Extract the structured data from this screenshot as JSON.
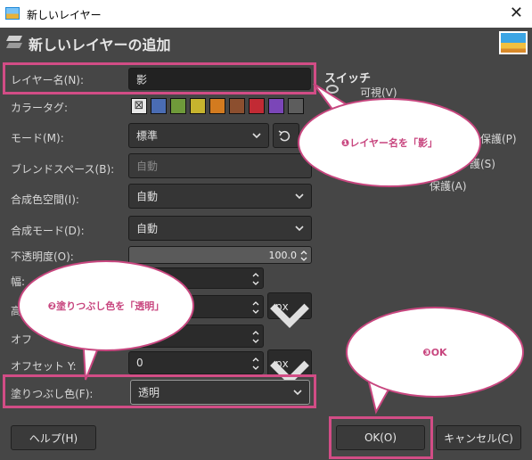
{
  "window": {
    "title": "新しいレイヤー",
    "close": "✕"
  },
  "dialog": {
    "heading": "新しいレイヤーの追加"
  },
  "form": {
    "layer_name_label": "レイヤー名(N):",
    "layer_name_value": "影",
    "color_tag_label": "カラータグ:",
    "mode_label": "モード(M):",
    "mode_value": "標準",
    "blend_space_label": "ブレンドスペース(B):",
    "blend_space_value": "自動",
    "composite_space_label": "合成色空間(I):",
    "composite_space_value": "自動",
    "composite_mode_label": "合成モード(D):",
    "composite_mode_value": "自動",
    "opacity_label": "不透明度(O):",
    "opacity_value": "100.0",
    "width_label": "幅:",
    "height_label_partial": "高",
    "offset_x_label_partial": "オフ",
    "offset_y_label": "オフセット Y:",
    "offset_y_value": "0",
    "unit_top": "px",
    "unit_bottom": "px",
    "fill_label": "塗りつぶし色(F):",
    "fill_value": "透明"
  },
  "color_tags": [
    "#777777",
    "#4a6cb3",
    "#6f9a3a",
    "#c7b42e",
    "#d37b1f",
    "#8c4f2f",
    "#c22a34",
    "#7b46b8",
    "#5d5d5d"
  ],
  "switches": {
    "heading": "スイッチ",
    "visible_partial": "可視(V)",
    "lock_pixels_partial": "を保護(P)",
    "lock_position_partial": "護(S)",
    "lock_alpha_partial": "保護(A)"
  },
  "buttons": {
    "help": "ヘルプ(H)",
    "ok": "OK(O)",
    "cancel": "キャンセル(C)"
  },
  "annotations": {
    "step1": "❶レイヤー名を「影」",
    "step2": "❷塗りつぶし色を「透明」",
    "step3": "❸OK"
  },
  "colors": {
    "highlight": "#d24d86",
    "dialog_bg": "#464646",
    "field_bg": "#2b2b2b"
  }
}
